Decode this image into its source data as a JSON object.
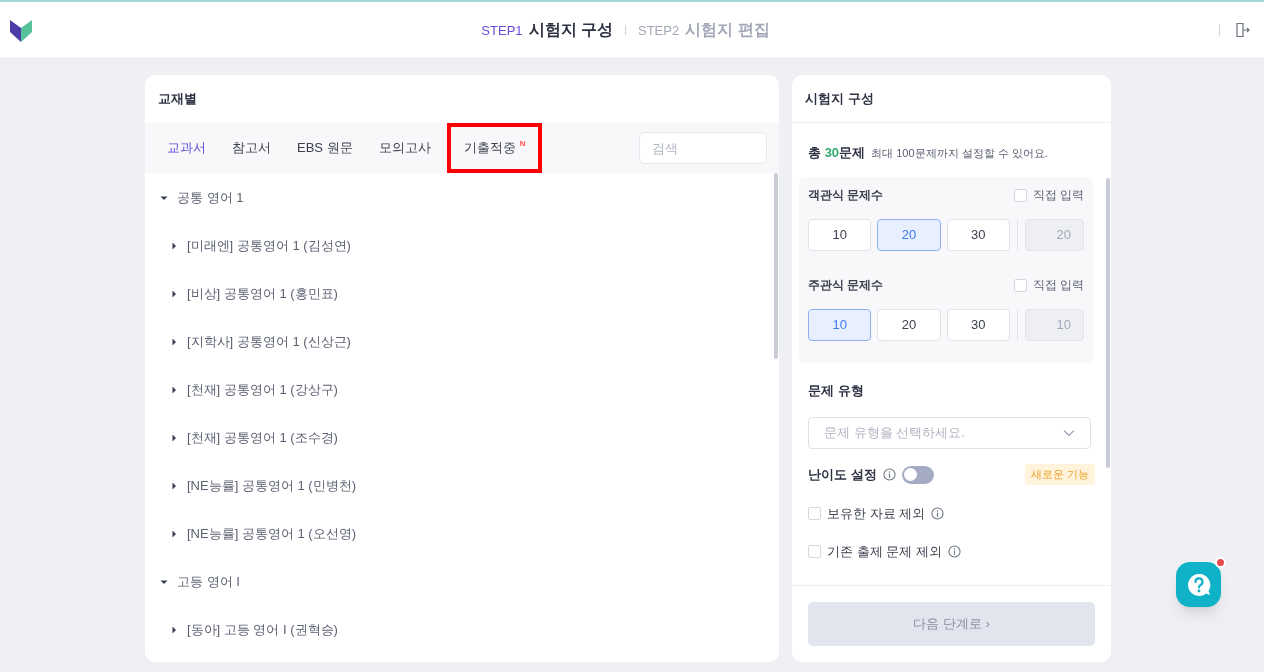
{
  "header": {
    "steps": [
      {
        "label": "STEP1",
        "title": "시험지 구성",
        "selected": true
      },
      {
        "label": "STEP2",
        "title": "시험지 편집",
        "selected": false
      }
    ]
  },
  "left_panel": {
    "title": "교재별",
    "tabs": [
      {
        "label": "교과서",
        "selected": true,
        "highlighted": false
      },
      {
        "label": "참고서",
        "selected": false,
        "highlighted": false
      },
      {
        "label": "EBS 원문",
        "selected": false,
        "highlighted": false
      },
      {
        "label": "모의고사",
        "selected": false,
        "highlighted": false
      },
      {
        "label": "기출적중",
        "badge": "N",
        "selected": false,
        "highlighted": true
      }
    ],
    "search": {
      "placeholder": "검색"
    },
    "tree": [
      {
        "label": "공통 영어 1",
        "expanded": true,
        "children": [
          {
            "label": "[미래엔] 공통영어 1 (김성연)",
            "expanded": false
          },
          {
            "label": "[비상] 공통영어 1 (홍민표)",
            "expanded": false
          },
          {
            "label": "[지학사] 공통영어 1 (신상근)",
            "expanded": false
          },
          {
            "label": "[천재] 공통영어 1 (강상구)",
            "expanded": false
          },
          {
            "label": "[천재] 공통영어 1 (조수경)",
            "expanded": false
          },
          {
            "label": "[NE능률] 공통영어 1 (민병천)",
            "expanded": false
          },
          {
            "label": "[NE능률] 공통영어 1 (오선영)",
            "expanded": false
          }
        ]
      },
      {
        "label": "고등 영어 I",
        "expanded": true,
        "children": [
          {
            "label": "[동아] 고등 영어 I (권혁승)",
            "expanded": false
          }
        ]
      }
    ]
  },
  "right_panel": {
    "title": "시험지 구성",
    "total": {
      "prefix": "총 ",
      "count": "30",
      "suffix": "문제",
      "hint": "최대 100문제까지 설정할 수 있어요."
    },
    "groups": [
      {
        "label": "객관식 문제수",
        "direct_input": {
          "label": "직접 입력",
          "checked": false
        },
        "options": [
          {
            "label": "10",
            "selected": false
          },
          {
            "label": "20",
            "selected": true
          },
          {
            "label": "30",
            "selected": false
          }
        ],
        "input_value": "20"
      },
      {
        "label": "주관식 문제수",
        "direct_input": {
          "label": "직접 입력",
          "checked": false
        },
        "options": [
          {
            "label": "10",
            "selected": true
          },
          {
            "label": "20",
            "selected": false
          },
          {
            "label": "30",
            "selected": false
          }
        ],
        "input_value": "10"
      }
    ],
    "type_label": "문제 유형",
    "type_select": {
      "placeholder": "문제 유형을 선택하세요."
    },
    "difficulty": {
      "label": "난이도 설정",
      "on": false,
      "badge": "새로운 기능"
    },
    "checks": [
      {
        "label": "보유한 자료 제외",
        "checked": false
      },
      {
        "label": "기존 출제 문제 제외",
        "checked": false
      }
    ],
    "next_button": {
      "label": "다음 단계로 ›",
      "disabled": true
    }
  }
}
